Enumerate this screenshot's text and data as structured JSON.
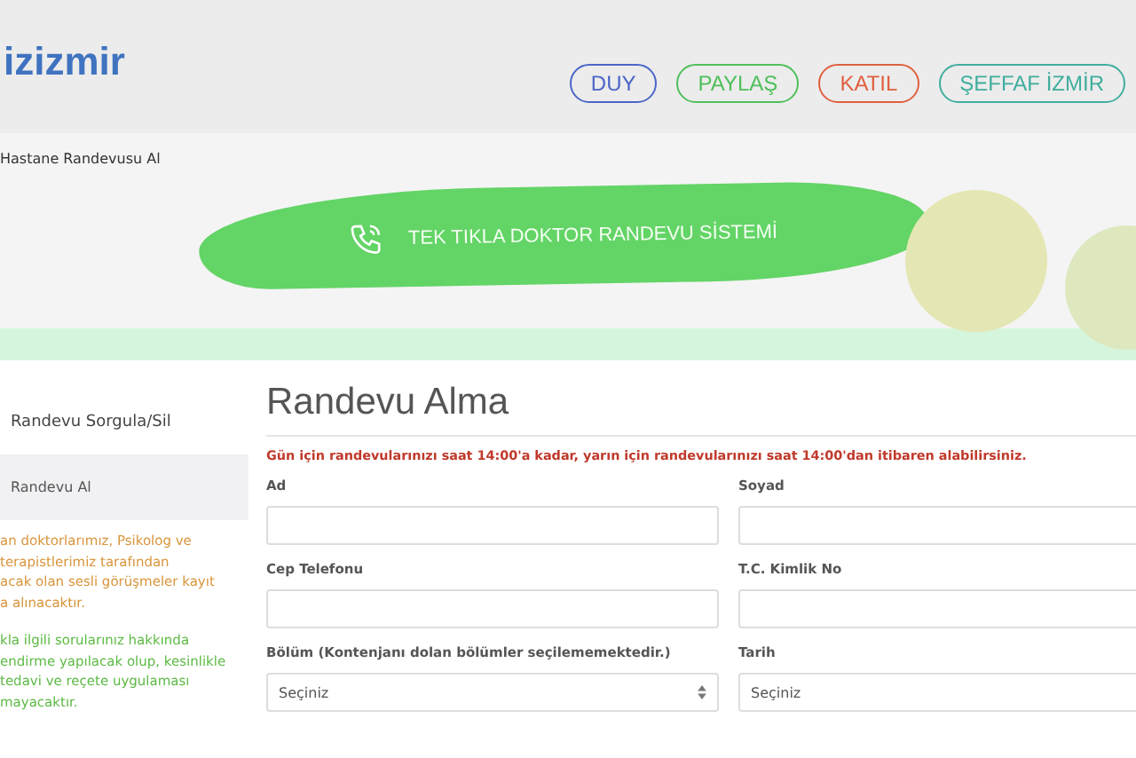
{
  "header": {
    "logo": "izizmir",
    "nav": [
      {
        "label": "DUY",
        "color": "#4b66c8"
      },
      {
        "label": "PAYLAŞ",
        "color": "#4fbf5a"
      },
      {
        "label": "KATIL",
        "color": "#e0603f"
      },
      {
        "label": "ŞEFFAF İZMİR",
        "color": "#3fae9d"
      }
    ]
  },
  "breadcrumb": "Hastane Randevusu Al",
  "banner": {
    "title": "TEK TIKLA DOKTOR RANDEVU SİSTEMİ"
  },
  "sidebar": {
    "items": [
      {
        "label": "Randevu Sorgula/Sil",
        "selected": false
      },
      {
        "label": "Randevu Al",
        "selected": true
      }
    ],
    "notes": [
      {
        "kind": "warning",
        "lines": [
          "an doktorlarımız, Psikolog ve",
          "terapistlerimiz tarafından",
          "acak olan sesli görüşmeler kayıt",
          "a alınacaktır."
        ]
      },
      {
        "kind": "info",
        "lines": [
          "kla ilgili sorularınız hakkında",
          "endirme yapılacak olup, kesinlikle",
          "tedavi ve reçete uygulaması",
          "mayacaktır."
        ]
      }
    ]
  },
  "form": {
    "title": "Randevu Alma",
    "notice": "Gün için randevularınızı saat 14:00'a kadar, yarın için randevularınızı saat 14:00'dan itibaren alabilirsiniz.",
    "fields": [
      {
        "label": "Ad",
        "kind": "text"
      },
      {
        "label": "Soyad",
        "kind": "text"
      },
      {
        "label": "Cep Telefonu",
        "kind": "text"
      },
      {
        "label": "T.C. Kimlik No",
        "kind": "text"
      },
      {
        "label": "Bölüm (Kontenjanı dolan bölümler seçilememektedir.)",
        "kind": "select",
        "value": "Seçiniz"
      },
      {
        "label": "Tarih",
        "kind": "date",
        "value": "Seçiniz"
      }
    ]
  }
}
